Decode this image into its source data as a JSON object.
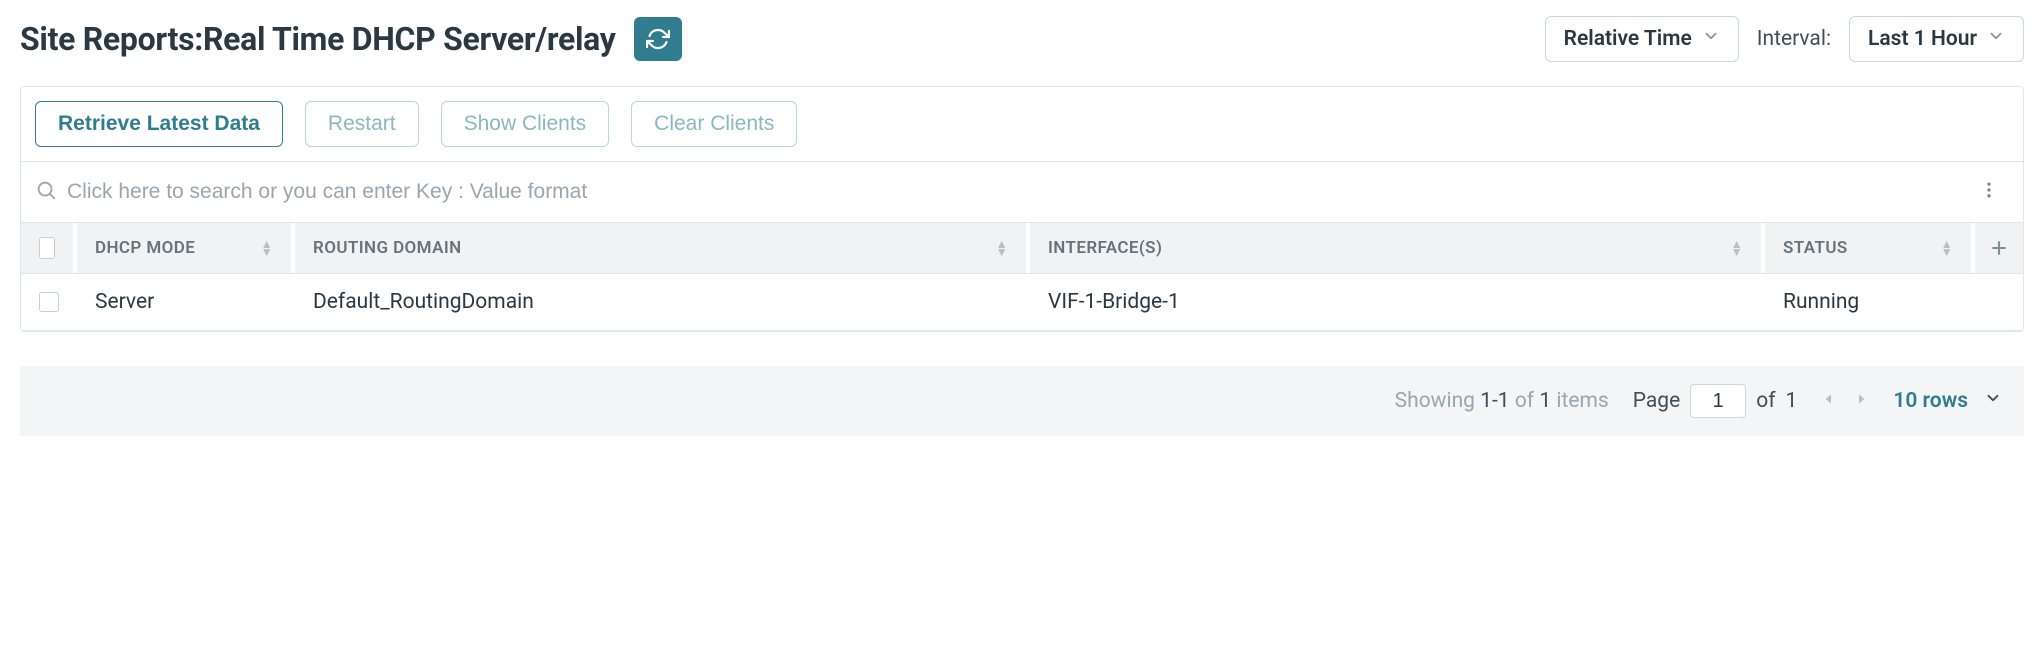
{
  "header": {
    "title": "Site Reports:Real Time DHCP Server/relay",
    "time_mode": "Relative Time",
    "interval_label": "Interval:",
    "interval_value": "Last 1 Hour"
  },
  "actions": {
    "retrieve": "Retrieve Latest Data",
    "restart": "Restart",
    "show_clients": "Show Clients",
    "clear_clients": "Clear Clients"
  },
  "search": {
    "placeholder": "Click here to search or you can enter Key : Value format"
  },
  "table": {
    "columns": {
      "mode": "DHCP MODE",
      "domain": "ROUTING DOMAIN",
      "iface": "INTERFACE(S)",
      "status": "STATUS"
    },
    "rows": [
      {
        "mode": "Server",
        "domain": "Default_RoutingDomain",
        "iface": "VIF-1-Bridge-1",
        "status": "Running"
      }
    ]
  },
  "pagination": {
    "showing_prefix": "Showing",
    "range": "1-1",
    "of_label": "of",
    "total_items": "1",
    "items_label": "items",
    "page_label": "Page",
    "current_page": "1",
    "total_pages": "1",
    "rows_label": "10 rows"
  }
}
